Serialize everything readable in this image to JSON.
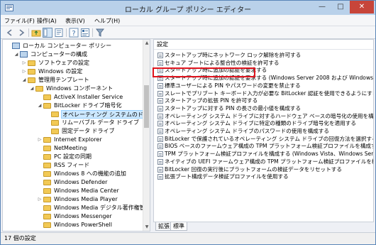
{
  "window": {
    "title": "ローカル グループ ポリシー エディター"
  },
  "title_buttons": {
    "minimize": "—",
    "maximize": "□",
    "close": "✕"
  },
  "menu": [
    "ファイル(F)",
    "操作(A)",
    "表示(V)",
    "ヘルプ(H)"
  ],
  "toolbar_icons": [
    "back-icon",
    "forward-icon",
    "up-folder-icon",
    "show-hide-tree-icon",
    "export-list-icon",
    "help-icon",
    "properties-icon",
    "filter-icon"
  ],
  "tree": [
    {
      "label": "ローカル コンピューター ポリシー",
      "level": 0,
      "expanded": null,
      "icon": "computer"
    },
    {
      "label": "コンピューターの構成",
      "level": 1,
      "expanded": true,
      "icon": "computer"
    },
    {
      "label": "ソフトウェアの設定",
      "level": 2,
      "expanded": false,
      "icon": "folder"
    },
    {
      "label": "Windows の設定",
      "level": 2,
      "expanded": false,
      "icon": "folder"
    },
    {
      "label": "管理用テンプレート",
      "level": 2,
      "expanded": true,
      "icon": "folder"
    },
    {
      "label": "Windows コンポーネント",
      "level": 3,
      "expanded": true,
      "icon": "folder"
    },
    {
      "label": "ActiveX Installer Service",
      "level": 4,
      "expanded": null,
      "icon": "folder"
    },
    {
      "label": "BitLocker ドライブ暗号化",
      "level": 4,
      "expanded": true,
      "icon": "folder"
    },
    {
      "label": "オペレーティング システムのドライブ",
      "level": 5,
      "expanded": null,
      "icon": "folder",
      "selected": true
    },
    {
      "label": "リムーバブル データ ドライブ",
      "level": 5,
      "expanded": null,
      "icon": "folder"
    },
    {
      "label": "固定データ ドライブ",
      "level": 5,
      "expanded": null,
      "icon": "folder"
    },
    {
      "label": "Internet Explorer",
      "level": 4,
      "expanded": false,
      "icon": "folder"
    },
    {
      "label": "NetMeeting",
      "level": 4,
      "expanded": null,
      "icon": "folder"
    },
    {
      "label": "PC 設定の同期",
      "level": 4,
      "expanded": null,
      "icon": "folder"
    },
    {
      "label": "RSS フィード",
      "level": 4,
      "expanded": null,
      "icon": "folder"
    },
    {
      "label": "Windows 8 への機能の追加",
      "level": 4,
      "expanded": null,
      "icon": "folder"
    },
    {
      "label": "Windows Defender",
      "level": 4,
      "expanded": null,
      "icon": "folder"
    },
    {
      "label": "Windows Media Center",
      "level": 4,
      "expanded": null,
      "icon": "folder"
    },
    {
      "label": "Windows Media Player",
      "level": 4,
      "expanded": false,
      "icon": "folder"
    },
    {
      "label": "Windows Media デジタル著作権管理",
      "level": 4,
      "expanded": null,
      "icon": "folder"
    },
    {
      "label": "Windows Messenger",
      "level": 4,
      "expanded": null,
      "icon": "folder"
    },
    {
      "label": "Windows PowerShell",
      "level": 4,
      "expanded": null,
      "icon": "folder"
    }
  ],
  "list": {
    "header": "設定",
    "rows": [
      "スタートアップ時にネットワーク ロック解除を許可する",
      "セキュア ブートによる整合性の検証を許可する",
      "スタートアップ時に追加の認証を要求する",
      "スタートアップ時に追加の認証を要求する (Windows Server 2008 および Windows Vista)",
      "標準ユーザーによる PIN やパスワードの変更を禁止する",
      "スレートでプリブート キーボード入力が必要な BitLocker 認証を使用できるようにする",
      "スタートアップの拡張 PIN を許可する",
      "スタートアップに対する PIN の長さの最小値を構成する",
      "オペレーティング システム ドライブに対するハードウェア ベースの暗号化の使用を構成する",
      "オペレーティング システム ドライブに特定の種類のドライブ暗号化を適用する",
      "オペレーティング システム ドライブのパスワードの使用を構成する",
      "BitLocker で保護されているオペレーティング システム ドライブの回復方法を選択する",
      "BIOS ベースのファームウェア構成の TPM プラットフォーム検証プロファイルを構成する",
      "TPM プラットフォーム検証プロファイルを構成する (Windows Vista、Windows Server 20...",
      "ネイティブの UEFI ファームウェア構成の TPM プラットフォーム検証プロファイルを構成する",
      "BitLocker 回復の実行後にプラットフォームの検証データをリセットする",
      "拡張ブート構成データ検証プロファイルを使用する"
    ]
  },
  "tabs": [
    "拡張",
    "標準"
  ],
  "status": "17 個の設定"
}
